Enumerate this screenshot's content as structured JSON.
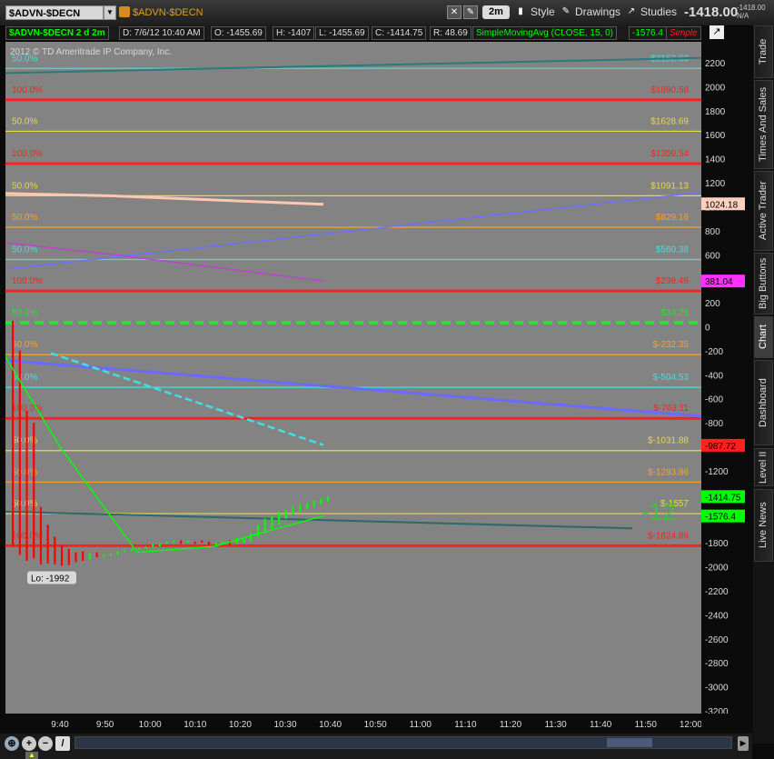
{
  "toolbar": {
    "symbol_value": "$ADVN-$DECN",
    "symbol_title": "$ADVN-$DECN",
    "aggregation": "2m",
    "style_label": "Style",
    "drawings_label": "Drawings",
    "studies_label": "Studies",
    "last_price": "-1418.00",
    "mini_price": "-1418.00",
    "mini_na": "N/A"
  },
  "infobar": {
    "symbol_period": "$ADVN-$DECN 2 d 2m",
    "date": "D: 7/6/12 10:40 AM",
    "open": "O: -1455.69",
    "high": "H: -1407",
    "low": "L: -1455.69",
    "close": "C: -1414.75",
    "range": "R: 48.69",
    "study": "SimpleMovingAvg (CLOSE, 15, 0)",
    "study_value": "-1576.4",
    "study_type": "Simple"
  },
  "side_tabs": [
    "Trade",
    "Times And Sales",
    "Active Trader",
    "Big Buttons",
    "Chart",
    "Dashboard",
    "Level II",
    "Live News"
  ],
  "colors": {
    "plot_bg": "#838383",
    "up_bar": "#00ff00",
    "down_bar": "#ff0000",
    "sma": "#00ff00",
    "fib_yellow": "#e8d84a",
    "fib_cyan": "#40e0e0",
    "fib_red": "#ff2020"
  },
  "chart_data": {
    "type": "bar",
    "copyright": "2012 © TD Ameritrade IP Company, Inc.",
    "ylim": [
      -3300,
      2300
    ],
    "x_ticks": [
      "9:40",
      "9:50",
      "10:00",
      "10:10",
      "10:20",
      "10:30",
      "10:40",
      "10:50",
      "11:00",
      "11:10",
      "11:20",
      "11:30",
      "11:40",
      "11:50",
      "12:00"
    ],
    "y_ticks": [
      2200,
      2000,
      1800,
      1600,
      1400,
      1200,
      1000,
      800,
      600,
      400,
      200,
      0,
      -200,
      -400,
      -600,
      -800,
      -1000,
      -1200,
      -1400,
      -1600,
      -1800,
      -2000,
      -2200,
      -2400,
      -2600,
      -2800,
      -3000,
      -3200
    ],
    "fib_levels": [
      {
        "value": 2152.63,
        "label": "$2152.63",
        "pct": "50.0%",
        "color": "#40e0e0"
      },
      {
        "value": 1890.58,
        "label": "$1890.58",
        "pct": "100.0%",
        "color": "#ff2020"
      },
      {
        "value": 1628.69,
        "label": "$1628.69",
        "pct": "50.0%",
        "color": "#e8d84a"
      },
      {
        "value": 1359.54,
        "label": "$1359.54",
        "pct": "100.0%",
        "color": "#ff2020"
      },
      {
        "value": 1091.13,
        "label": "$1091.13",
        "pct": "50.0%",
        "color": "#e8d84a"
      },
      {
        "value": 829.16,
        "label": "$829.16",
        "pct": "50.0%",
        "color": "#ffa020"
      },
      {
        "value": 560.38,
        "label": "$560.38",
        "pct": "50.0%",
        "color": "#40e0e0"
      },
      {
        "value": 298.46,
        "label": "$298.46",
        "pct": "100.0%",
        "color": "#ff2020"
      },
      {
        "value": 34.75,
        "label": "$34.75",
        "pct": "50.0%",
        "color": "#30e030"
      },
      {
        "value": -232.35,
        "label": "$-232.35",
        "pct": "50.0%",
        "color": "#ffa020"
      },
      {
        "value": -504.53,
        "label": "$-504.53",
        "pct": "50.0%",
        "color": "#40e0e0"
      },
      {
        "value": -763.11,
        "label": "$-763.11",
        "pct": "100.0%",
        "color": "#ff2020"
      },
      {
        "value": -1031.88,
        "label": "$-1031.88",
        "pct": "50.0%",
        "color": "#e8d84a"
      },
      {
        "value": -1293.86,
        "label": "$-1293.86",
        "pct": "50.0%",
        "color": "#ffa020"
      },
      {
        "value": -1557,
        "label": "$-1557",
        "pct": "50.0%",
        "color": "#e8d84a"
      },
      {
        "value": -1824.86,
        "label": "$-1824.86",
        "pct": "100.0%",
        "color": "#ff2020"
      }
    ],
    "bubbles": [
      {
        "value": 1024.18,
        "label": "1024.18",
        "bg": "#ffd0c0"
      },
      {
        "value": 381.04,
        "label": "381.04",
        "bg": "#ff30ff"
      },
      {
        "value": -987.72,
        "label": "-987.72",
        "bg": "#ff2020"
      },
      {
        "value": -1414.75,
        "label": "-1414.75",
        "bg": "#00ff00"
      },
      {
        "value": -1576.4,
        "label": "-1576.4",
        "bg": "#00ff00"
      }
    ],
    "low_label": "Lo: -1992",
    "low_value": -1992,
    "big_label": "-12"
  }
}
